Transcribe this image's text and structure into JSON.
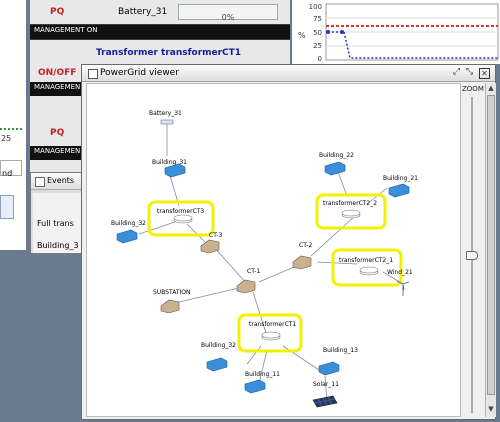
{
  "bg_panels": {
    "left_strip": {
      "num": "25",
      "text": "nd"
    },
    "battery_row": {
      "mode": "PQ",
      "name": "Battery_31",
      "value": "0%"
    },
    "management_label_1": "MANAGEMENT ON",
    "transformer_title": "Transformer transformerCT1",
    "onoff": "ON/OFF",
    "management_label_2": "MANAGEMEN",
    "pq2": "PQ",
    "management_label_3": "MANAGEMEN",
    "events": {
      "title": "Events",
      "row1": "Full trans",
      "row2": "Building_3"
    }
  },
  "chart": {
    "ylabel": "%",
    "ticks": [
      "100",
      "75",
      "50",
      "25",
      "0"
    ],
    "colors": {
      "red": "#e03030",
      "blue": "#2233cc"
    }
  },
  "viewer": {
    "title": "PowerGrid viewer",
    "zoom_label": "ZOOM",
    "zoom_level": 0.42,
    "nodes": {
      "battery": "Battery_31",
      "b31": "Building_31",
      "b32a": "Building_32",
      "t3": "transformerCT3",
      "ct3": "CT-3",
      "b22": "Building_22",
      "b21": "Building_21",
      "t22": "transformerCT2_2",
      "ct2": "CT-2",
      "t21": "transformerCT2_1",
      "wind": "Wind_21",
      "ct1": "CT-1",
      "sub": "SUBSTATION",
      "t1": "transformerCT1",
      "b32b": "Building_32",
      "b13": "Building_13",
      "b11": "Building_11",
      "solar": "Solar_11"
    },
    "highlight_color": "#f2f200"
  }
}
